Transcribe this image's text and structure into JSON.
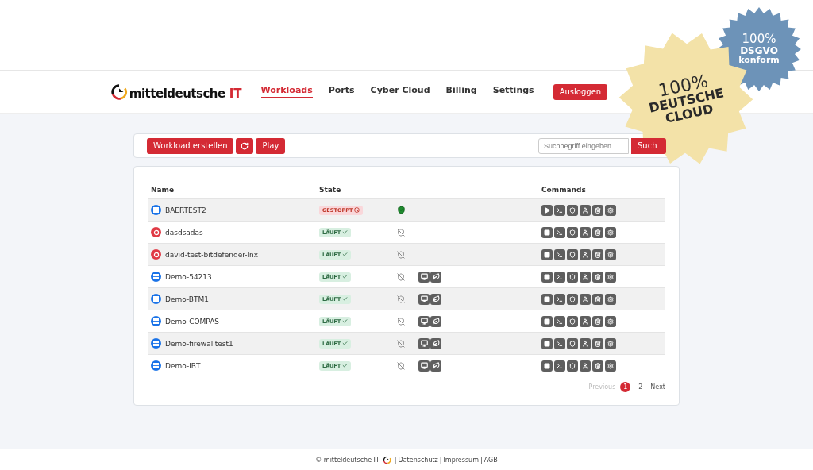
{
  "header": {
    "logo_text": "mitteldeutsche",
    "logo_accent": "IT",
    "nav": [
      {
        "label": "Workloads",
        "selected": true
      },
      {
        "label": "Ports",
        "selected": false
      },
      {
        "label": "Cyber Cloud",
        "selected": false
      },
      {
        "label": "Billing",
        "selected": false
      },
      {
        "label": "Settings",
        "selected": false
      }
    ],
    "logout": "Ausloggen"
  },
  "stickers": [
    {
      "kind": "blue",
      "lines": [
        "100%",
        "DSGVO",
        "konform"
      ]
    },
    {
      "kind": "yellow",
      "lines": [
        "100%",
        "DEUTSCHE",
        "CLOUD"
      ]
    }
  ],
  "toolbar": {
    "create": "Workload erstellen",
    "play": "Play",
    "search": {
      "placeholder": "Suchbegriff eingeben"
    },
    "search_button": "Such"
  },
  "table": {
    "columns": [
      "Name",
      "State",
      "Commands"
    ],
    "rows": [
      {
        "name": "BAERTEST2",
        "kind": "windows",
        "state": {
          "label": "GESTOPPT",
          "kind": "stopped"
        },
        "protected": true,
        "extras": false
      },
      {
        "name": "dasdsadas",
        "kind": "linux",
        "state": {
          "label": "LÄUFT",
          "kind": "running"
        },
        "protected": false,
        "extras": false
      },
      {
        "name": "david-test-bitdefender-lnx",
        "kind": "linux",
        "state": {
          "label": "LÄUFT",
          "kind": "running"
        },
        "protected": false,
        "extras": false
      },
      {
        "name": "Demo-54213",
        "kind": "windows",
        "state": {
          "label": "LÄUFT",
          "kind": "running"
        },
        "protected": false,
        "extras": true
      },
      {
        "name": "Demo-BTM1",
        "kind": "windows",
        "state": {
          "label": "LÄUFT",
          "kind": "running"
        },
        "protected": false,
        "extras": true
      },
      {
        "name": "Demo-COMPAS",
        "kind": "windows",
        "state": {
          "label": "LÄUFT",
          "kind": "running"
        },
        "protected": false,
        "extras": true
      },
      {
        "name": "Demo-firewalltest1",
        "kind": "windows",
        "state": {
          "label": "LÄUFT",
          "kind": "running"
        },
        "protected": false,
        "extras": true
      },
      {
        "name": "Demo-IBT",
        "kind": "windows",
        "state": {
          "label": "LÄUFT",
          "kind": "running"
        },
        "protected": false,
        "extras": true
      }
    ]
  },
  "pagination": {
    "previous": "Previous",
    "pages": [
      {
        "label": "1",
        "selected": true
      },
      {
        "label": "2",
        "selected": false
      }
    ],
    "next": "Next"
  },
  "footer": {
    "copyright": "© mitteldeutsche IT",
    "separator": "|",
    "links": [
      "Datenschutz",
      "Impressum",
      "AGB"
    ]
  }
}
